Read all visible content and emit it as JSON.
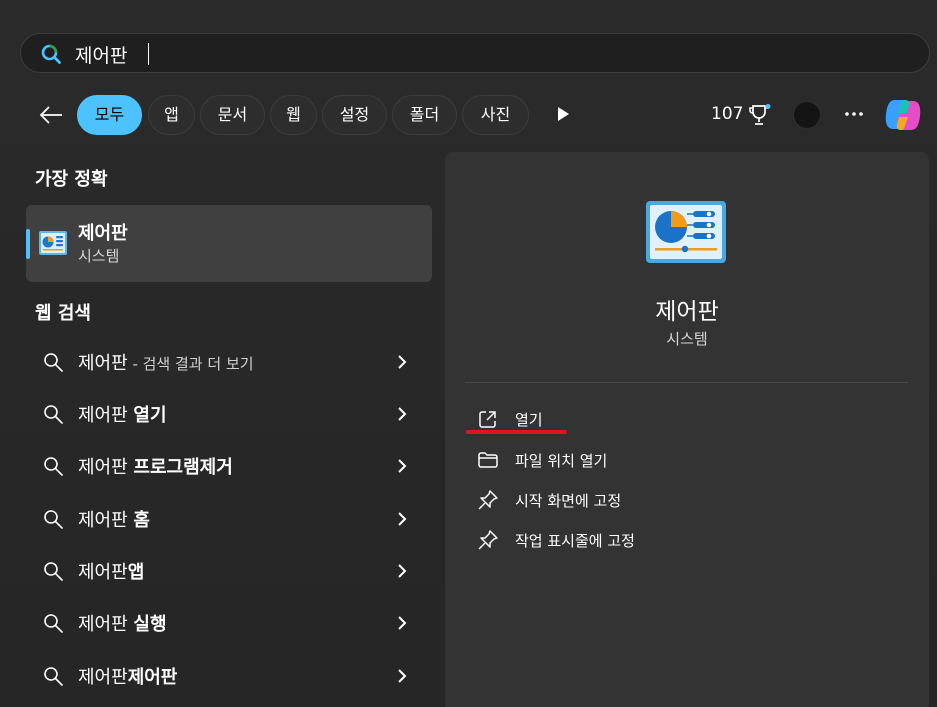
{
  "search": {
    "value": "제어판"
  },
  "filters": [
    {
      "label": "모두",
      "active": true
    },
    {
      "label": "앱",
      "active": false
    },
    {
      "label": "문서",
      "active": false
    },
    {
      "label": "웹",
      "active": false
    },
    {
      "label": "설정",
      "active": false
    },
    {
      "label": "폴더",
      "active": false
    },
    {
      "label": "사진",
      "active": false
    }
  ],
  "toolbar": {
    "points": "107"
  },
  "best_match": {
    "section_label": "가장 정확",
    "title": "제어판",
    "subtitle": "시스템"
  },
  "web_search": {
    "section_label": "웹 검색",
    "items": [
      {
        "prefix": "제어판",
        "bold": "",
        "dim": " - 검색 결과 더 보기"
      },
      {
        "prefix": "제어판 ",
        "bold": "열기",
        "dim": ""
      },
      {
        "prefix": "제어판 ",
        "bold": "프로그램제거",
        "dim": ""
      },
      {
        "prefix": "제어판 ",
        "bold": "홈",
        "dim": ""
      },
      {
        "prefix": "제어판",
        "bold": "앱",
        "dim": ""
      },
      {
        "prefix": "제어판 ",
        "bold": "실행",
        "dim": ""
      },
      {
        "prefix": "제어판",
        "bold": "제어판",
        "dim": ""
      }
    ]
  },
  "detail": {
    "title": "제어판",
    "subtitle": "시스템",
    "actions": [
      {
        "label": "열기",
        "icon": "open-external-icon"
      },
      {
        "label": "파일 위치 열기",
        "icon": "folder-icon"
      },
      {
        "label": "시작 화면에 고정",
        "icon": "pin-icon"
      },
      {
        "label": "작업 표시줄에 고정",
        "icon": "pin-icon"
      }
    ]
  },
  "colors": {
    "accent": "#4cc2ff",
    "annotation": "#e0141c",
    "background": "#262626",
    "panel": "#333333"
  }
}
